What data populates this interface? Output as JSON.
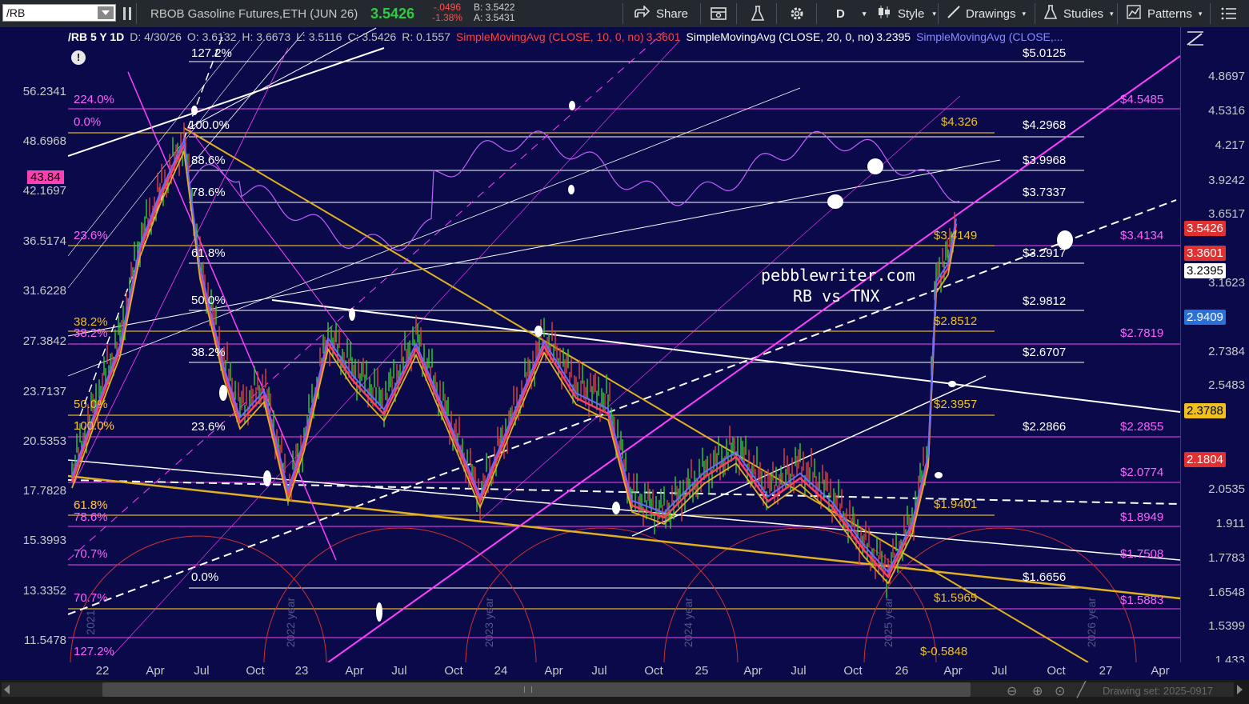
{
  "toolbar": {
    "symbol": "/RB",
    "description": "RBOB Gasoline Futures,ETH (JUN 26)",
    "last_price": "3.5426",
    "change": "-.0496",
    "change_pct": "-1.38%",
    "bid": "B: 3.5422",
    "ask": "A: 3.5431",
    "share_label": "Share",
    "interval_label": "D",
    "style_label": "Style",
    "drawings_label": "Drawings",
    "studies_label": "Studies",
    "patterns_label": "Patterns"
  },
  "legend": {
    "symbol_info": "/RB 5 Y 1D",
    "date": "D: 4/30/26",
    "open": "O: 3.6132",
    "high": "H: 3.6673",
    "low": "L: 3.5116",
    "close": "C: 3.5426",
    "range": "R: 0.1557",
    "sma10_label": "SimpleMovingAvg (CLOSE, 10, 0, no)",
    "sma10_value": "3.3601",
    "sma20_label": "SimpleMovingAvg (CLOSE, 20, 0, no)",
    "sma20_value": "3.2395",
    "sma_other_label": "SimpleMovingAvg (CLOSE,..."
  },
  "right_axis": [
    "4.8697",
    "4.5316",
    "4.217",
    "3.9242",
    "3.6517",
    "3.1623",
    "2.7384",
    "2.5483",
    "2.0535",
    "1.911",
    "1.7783",
    "1.6548",
    "1.5399",
    "1.433"
  ],
  "right_tags": [
    {
      "text": "3.5426",
      "bg": "#e03030",
      "fg": "#ffffff"
    },
    {
      "text": "3.3601",
      "bg": "#e03030",
      "fg": "#ffffff"
    },
    {
      "text": "3.2395",
      "bg": "#ffffff",
      "fg": "#000000"
    },
    {
      "text": "2.9409",
      "bg": "#2b6fd8",
      "fg": "#ffffff"
    },
    {
      "text": "2.3788",
      "bg": "#f0c020",
      "fg": "#000000"
    },
    {
      "text": "2.1804",
      "bg": "#e03030",
      "fg": "#ffffff"
    }
  ],
  "left_axis": [
    "56.2341",
    "48.6968",
    "42.1697",
    "36.5174",
    "31.6228",
    "27.3842",
    "23.7137",
    "20.5353",
    "17.7828",
    "15.3993",
    "13.3352",
    "11.5478"
  ],
  "left_tag": "43.84",
  "x_axis": [
    "22",
    "Apr",
    "Jul",
    "Oct",
    "23",
    "Apr",
    "Jul",
    "Oct",
    "24",
    "Apr",
    "Jul",
    "Oct",
    "25",
    "Apr",
    "Jul",
    "Oct",
    "26",
    "Apr",
    "Jul",
    "Oct",
    "27",
    "Apr"
  ],
  "levels_white": [
    "$5.0125",
    "$4.2968",
    "$3.9968",
    "$3.7337",
    "$3.2917",
    "$2.9812",
    "$2.6707",
    "$2.2866",
    "$1.6656"
  ],
  "levels_magenta": [
    "$4.5485",
    "$3.4134",
    "$2.7819",
    "$2.2855",
    "$2.0774",
    "$1.8949",
    "$1.7508",
    "$1.5883"
  ],
  "levels_gold": [
    "$4.326",
    "$3.4149",
    "$2.8512",
    "$2.3957",
    "$1.9401",
    "$1.5965",
    "$-0.5848"
  ],
  "fib_white": [
    "127.2%",
    "100.0%",
    "88.6%",
    "78.6%",
    "61.8%",
    "50.0%",
    "38.2%",
    "23.6%",
    "0.0%"
  ],
  "fib_magenta": [
    "224.0%",
    "0.0%",
    "23.6%",
    "38.2%",
    "100.0%",
    "61.8%",
    "78.6%",
    "70.7%",
    "70.7%",
    "127.2%"
  ],
  "fib_gold": [
    "38.2%",
    "50.0%",
    "100.0%",
    "61.8%"
  ],
  "watermark": {
    "line1": "pebblewriter.com",
    "line2": "RB vs TNX"
  },
  "cycle_labels": [
    "2021",
    "2022 year",
    "2023 year",
    "2024 year",
    "2025 year",
    "2026 year"
  ],
  "footer": {
    "drawing_set": "Drawing set: 2025-0917"
  }
}
